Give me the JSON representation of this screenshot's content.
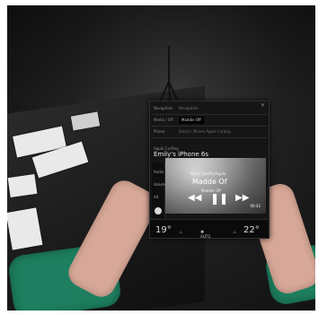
{
  "ui": {
    "header": {
      "navigation_label": "Navigation",
      "navigation_value": "Navigation",
      "media_label": "Media / Off",
      "media_value": "Maddie Off",
      "phone_label": "Phone",
      "phone_value": "Emily's iPhone Apple Carplay"
    },
    "source": {
      "title": "Apple CarPlay",
      "name": "Emily's iPhone 6s"
    },
    "side_panel": {
      "item_1": "Audio",
      "item_2": "Volume",
      "item_3": "Alt"
    },
    "player": {
      "source_label": "Music Spotify/Apple",
      "title": "Madde Of",
      "artist": "Maddie Off",
      "time": "00:42"
    },
    "climate": {
      "left_temp": "19°",
      "right_temp": "22°",
      "mode": "AUTO"
    }
  },
  "icons": {
    "close": "close-icon",
    "seat_heat_left": "seat-heat-icon",
    "fan": "fan-icon",
    "seat_heat_right": "seat-heat-icon",
    "prev": "previous-icon",
    "pause": "pause-icon",
    "next": "next-icon"
  },
  "colors": {
    "tablet_bg": "#151515",
    "sleeve": "#1d7f5f",
    "skin": "#d7a797"
  }
}
